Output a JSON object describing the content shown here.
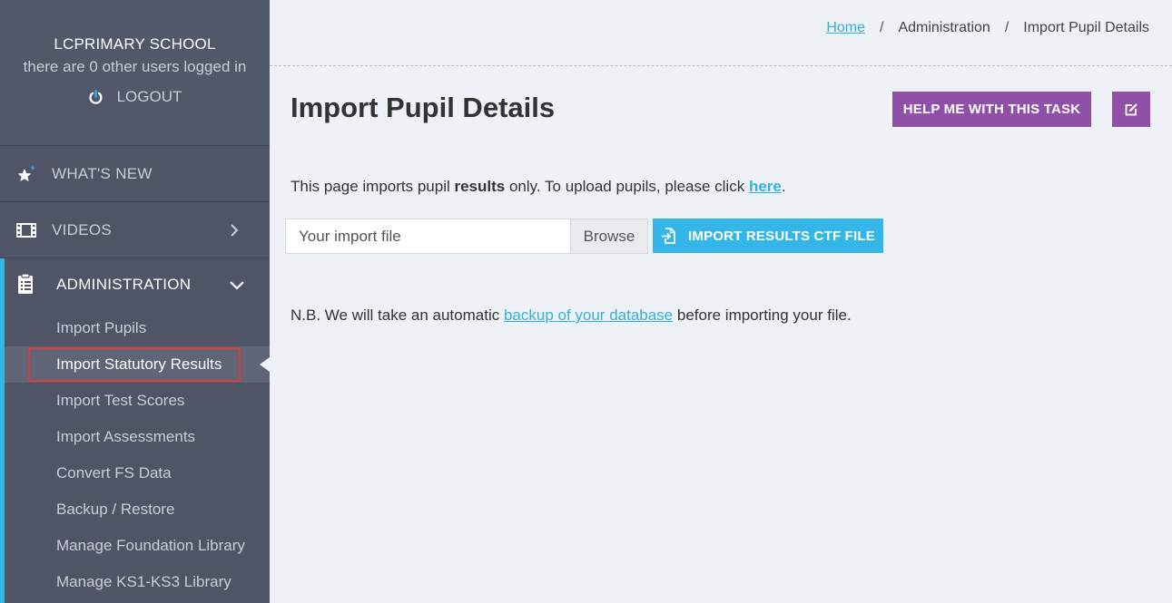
{
  "sidebar": {
    "school_name": "LCPRIMARY SCHOOL",
    "users_text": "there are 0 other users logged in",
    "logout_label": "LOGOUT",
    "nav": {
      "whats_new": "WHAT'S NEW",
      "videos": "VIDEOS",
      "administration": "ADMINISTRATION"
    },
    "admin_items": [
      "Import Pupils",
      "Import Statutory Results",
      "Import Test Scores",
      "Import Assessments",
      "Convert FS Data",
      "Backup / Restore",
      "Manage Foundation Library",
      "Manage KS1-KS3 Library"
    ],
    "active_item": "Import Statutory Results"
  },
  "breadcrumb": {
    "home": "Home",
    "sep": "/",
    "level2": "Administration",
    "current": "Import Pupil Details"
  },
  "main": {
    "title": "Import Pupil Details",
    "help_label": "HELP ME WITH THIS TASK",
    "info": {
      "before": "This page imports pupil ",
      "bold": "results",
      "middle": " only. To upload pupils, please click ",
      "link": "here",
      "after": "."
    },
    "file_placeholder": "Your import file",
    "browse_label": "Browse",
    "import_label": "IMPORT RESULTS CTF FILE",
    "note": {
      "before": "N.B. We will take an automatic ",
      "link": "backup of your database",
      "after": " before importing your file."
    }
  },
  "colors": {
    "sidebar_bg": "#4f5566",
    "accent_blue": "#35b6e8",
    "purple": "#9150a8",
    "highlight_red": "#e03a3a"
  }
}
